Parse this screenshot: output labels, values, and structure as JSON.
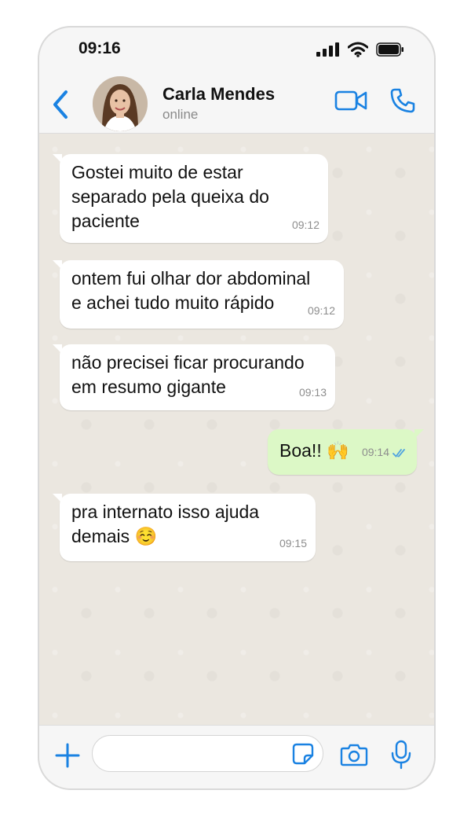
{
  "status_bar": {
    "time": "09:16"
  },
  "header": {
    "contact_name": "Carla Mendes",
    "contact_status": "online"
  },
  "messages": [
    {
      "direction": "incoming",
      "lines": [
        "Gostei muito de estar",
        "separado pela queixa do",
        "paciente"
      ],
      "time": "09:12"
    },
    {
      "direction": "incoming",
      "lines": [
        "ontem fui olhar dor abdominal",
        "e achei tudo muito rápido"
      ],
      "time": "09:12"
    },
    {
      "direction": "incoming",
      "lines": [
        "não precisei ficar procurando",
        "em resumo gigante"
      ],
      "time": "09:13"
    },
    {
      "direction": "outgoing",
      "lines": [
        "Boa!! 🙌"
      ],
      "time": "09:14",
      "read": true
    },
    {
      "direction": "incoming",
      "lines": [
        "pra internato isso ajuda",
        "demais ☺️"
      ],
      "time": "09:15"
    }
  ],
  "composer": {
    "placeholder": ""
  },
  "colors": {
    "accent": "#1a82e2",
    "outgoing_bubble": "#dcf8c6",
    "incoming_bubble": "#ffffff",
    "chat_bg": "#ebe7e0",
    "read_ticks": "#4fa3e0"
  },
  "icons": {
    "back": "chevron-left-icon",
    "video": "video-camera-icon",
    "call": "phone-icon",
    "add": "plus-icon",
    "sticker": "sticker-icon",
    "camera": "camera-icon",
    "mic": "microphone-icon",
    "signal": "cellular-signal-icon",
    "wifi": "wifi-icon",
    "battery": "battery-icon"
  }
}
